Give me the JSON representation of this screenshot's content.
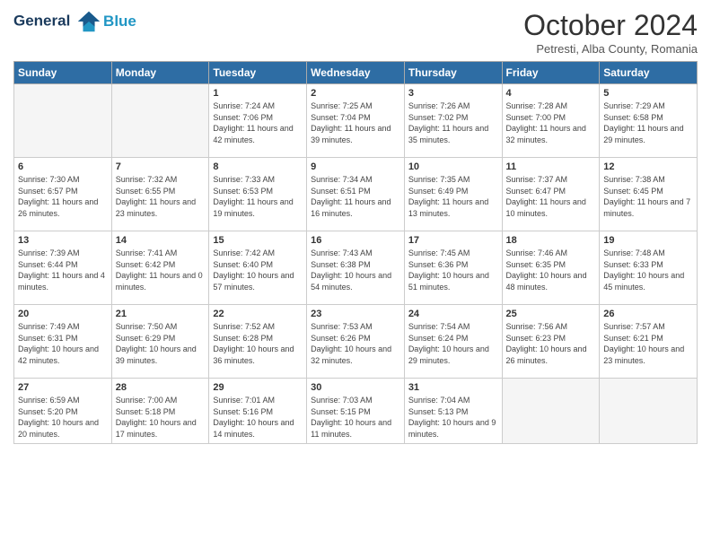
{
  "header": {
    "logo_line1": "General",
    "logo_line2": "Blue",
    "month": "October 2024",
    "location": "Petresti, Alba County, Romania"
  },
  "days_of_week": [
    "Sunday",
    "Monday",
    "Tuesday",
    "Wednesday",
    "Thursday",
    "Friday",
    "Saturday"
  ],
  "weeks": [
    [
      {
        "day": "",
        "info": ""
      },
      {
        "day": "",
        "info": ""
      },
      {
        "day": "1",
        "info": "Sunrise: 7:24 AM\nSunset: 7:06 PM\nDaylight: 11 hours and 42 minutes."
      },
      {
        "day": "2",
        "info": "Sunrise: 7:25 AM\nSunset: 7:04 PM\nDaylight: 11 hours and 39 minutes."
      },
      {
        "day": "3",
        "info": "Sunrise: 7:26 AM\nSunset: 7:02 PM\nDaylight: 11 hours and 35 minutes."
      },
      {
        "day": "4",
        "info": "Sunrise: 7:28 AM\nSunset: 7:00 PM\nDaylight: 11 hours and 32 minutes."
      },
      {
        "day": "5",
        "info": "Sunrise: 7:29 AM\nSunset: 6:58 PM\nDaylight: 11 hours and 29 minutes."
      }
    ],
    [
      {
        "day": "6",
        "info": "Sunrise: 7:30 AM\nSunset: 6:57 PM\nDaylight: 11 hours and 26 minutes."
      },
      {
        "day": "7",
        "info": "Sunrise: 7:32 AM\nSunset: 6:55 PM\nDaylight: 11 hours and 23 minutes."
      },
      {
        "day": "8",
        "info": "Sunrise: 7:33 AM\nSunset: 6:53 PM\nDaylight: 11 hours and 19 minutes."
      },
      {
        "day": "9",
        "info": "Sunrise: 7:34 AM\nSunset: 6:51 PM\nDaylight: 11 hours and 16 minutes."
      },
      {
        "day": "10",
        "info": "Sunrise: 7:35 AM\nSunset: 6:49 PM\nDaylight: 11 hours and 13 minutes."
      },
      {
        "day": "11",
        "info": "Sunrise: 7:37 AM\nSunset: 6:47 PM\nDaylight: 11 hours and 10 minutes."
      },
      {
        "day": "12",
        "info": "Sunrise: 7:38 AM\nSunset: 6:45 PM\nDaylight: 11 hours and 7 minutes."
      }
    ],
    [
      {
        "day": "13",
        "info": "Sunrise: 7:39 AM\nSunset: 6:44 PM\nDaylight: 11 hours and 4 minutes."
      },
      {
        "day": "14",
        "info": "Sunrise: 7:41 AM\nSunset: 6:42 PM\nDaylight: 11 hours and 0 minutes."
      },
      {
        "day": "15",
        "info": "Sunrise: 7:42 AM\nSunset: 6:40 PM\nDaylight: 10 hours and 57 minutes."
      },
      {
        "day": "16",
        "info": "Sunrise: 7:43 AM\nSunset: 6:38 PM\nDaylight: 10 hours and 54 minutes."
      },
      {
        "day": "17",
        "info": "Sunrise: 7:45 AM\nSunset: 6:36 PM\nDaylight: 10 hours and 51 minutes."
      },
      {
        "day": "18",
        "info": "Sunrise: 7:46 AM\nSunset: 6:35 PM\nDaylight: 10 hours and 48 minutes."
      },
      {
        "day": "19",
        "info": "Sunrise: 7:48 AM\nSunset: 6:33 PM\nDaylight: 10 hours and 45 minutes."
      }
    ],
    [
      {
        "day": "20",
        "info": "Sunrise: 7:49 AM\nSunset: 6:31 PM\nDaylight: 10 hours and 42 minutes."
      },
      {
        "day": "21",
        "info": "Sunrise: 7:50 AM\nSunset: 6:29 PM\nDaylight: 10 hours and 39 minutes."
      },
      {
        "day": "22",
        "info": "Sunrise: 7:52 AM\nSunset: 6:28 PM\nDaylight: 10 hours and 36 minutes."
      },
      {
        "day": "23",
        "info": "Sunrise: 7:53 AM\nSunset: 6:26 PM\nDaylight: 10 hours and 32 minutes."
      },
      {
        "day": "24",
        "info": "Sunrise: 7:54 AM\nSunset: 6:24 PM\nDaylight: 10 hours and 29 minutes."
      },
      {
        "day": "25",
        "info": "Sunrise: 7:56 AM\nSunset: 6:23 PM\nDaylight: 10 hours and 26 minutes."
      },
      {
        "day": "26",
        "info": "Sunrise: 7:57 AM\nSunset: 6:21 PM\nDaylight: 10 hours and 23 minutes."
      }
    ],
    [
      {
        "day": "27",
        "info": "Sunrise: 6:59 AM\nSunset: 5:20 PM\nDaylight: 10 hours and 20 minutes."
      },
      {
        "day": "28",
        "info": "Sunrise: 7:00 AM\nSunset: 5:18 PM\nDaylight: 10 hours and 17 minutes."
      },
      {
        "day": "29",
        "info": "Sunrise: 7:01 AM\nSunset: 5:16 PM\nDaylight: 10 hours and 14 minutes."
      },
      {
        "day": "30",
        "info": "Sunrise: 7:03 AM\nSunset: 5:15 PM\nDaylight: 10 hours and 11 minutes."
      },
      {
        "day": "31",
        "info": "Sunrise: 7:04 AM\nSunset: 5:13 PM\nDaylight: 10 hours and 9 minutes."
      },
      {
        "day": "",
        "info": ""
      },
      {
        "day": "",
        "info": ""
      }
    ]
  ]
}
